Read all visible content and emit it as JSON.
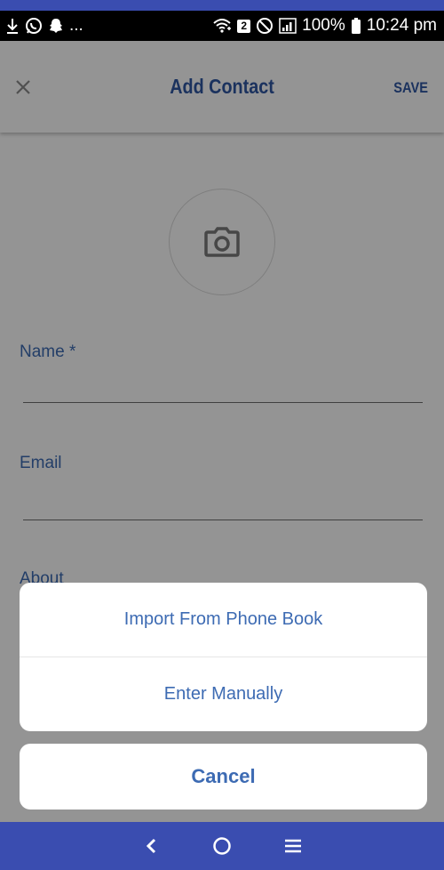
{
  "status_bar": {
    "more_indicator": "...",
    "battery_percent": "100%",
    "time": "10:24 pm",
    "sim_slot": "2",
    "icons_left": [
      "download-icon",
      "whatsapp-icon",
      "snapchat-icon"
    ],
    "icons_right": [
      "wifi-icon",
      "do-not-disturb-icon",
      "signal-icon",
      "battery-icon"
    ]
  },
  "header": {
    "title": "Add Contact",
    "save_label": "SAVE",
    "close_icon": "close-icon"
  },
  "form": {
    "photo_icon": "camera-icon",
    "fields": [
      {
        "label": "Name *",
        "value": ""
      },
      {
        "label": "Email",
        "value": ""
      },
      {
        "label": "About",
        "value": ""
      }
    ]
  },
  "action_sheet": {
    "options": [
      {
        "label": "Import From Phone Book"
      },
      {
        "label": "Enter Manually"
      }
    ],
    "cancel_label": "Cancel"
  },
  "nav_bar": {
    "icons": [
      "back-icon",
      "home-icon",
      "recents-icon"
    ]
  },
  "colors": {
    "accent": "#2f57a3",
    "link": "#3d6bb3",
    "nav_background": "#3a4db0",
    "status_background": "#000000"
  }
}
